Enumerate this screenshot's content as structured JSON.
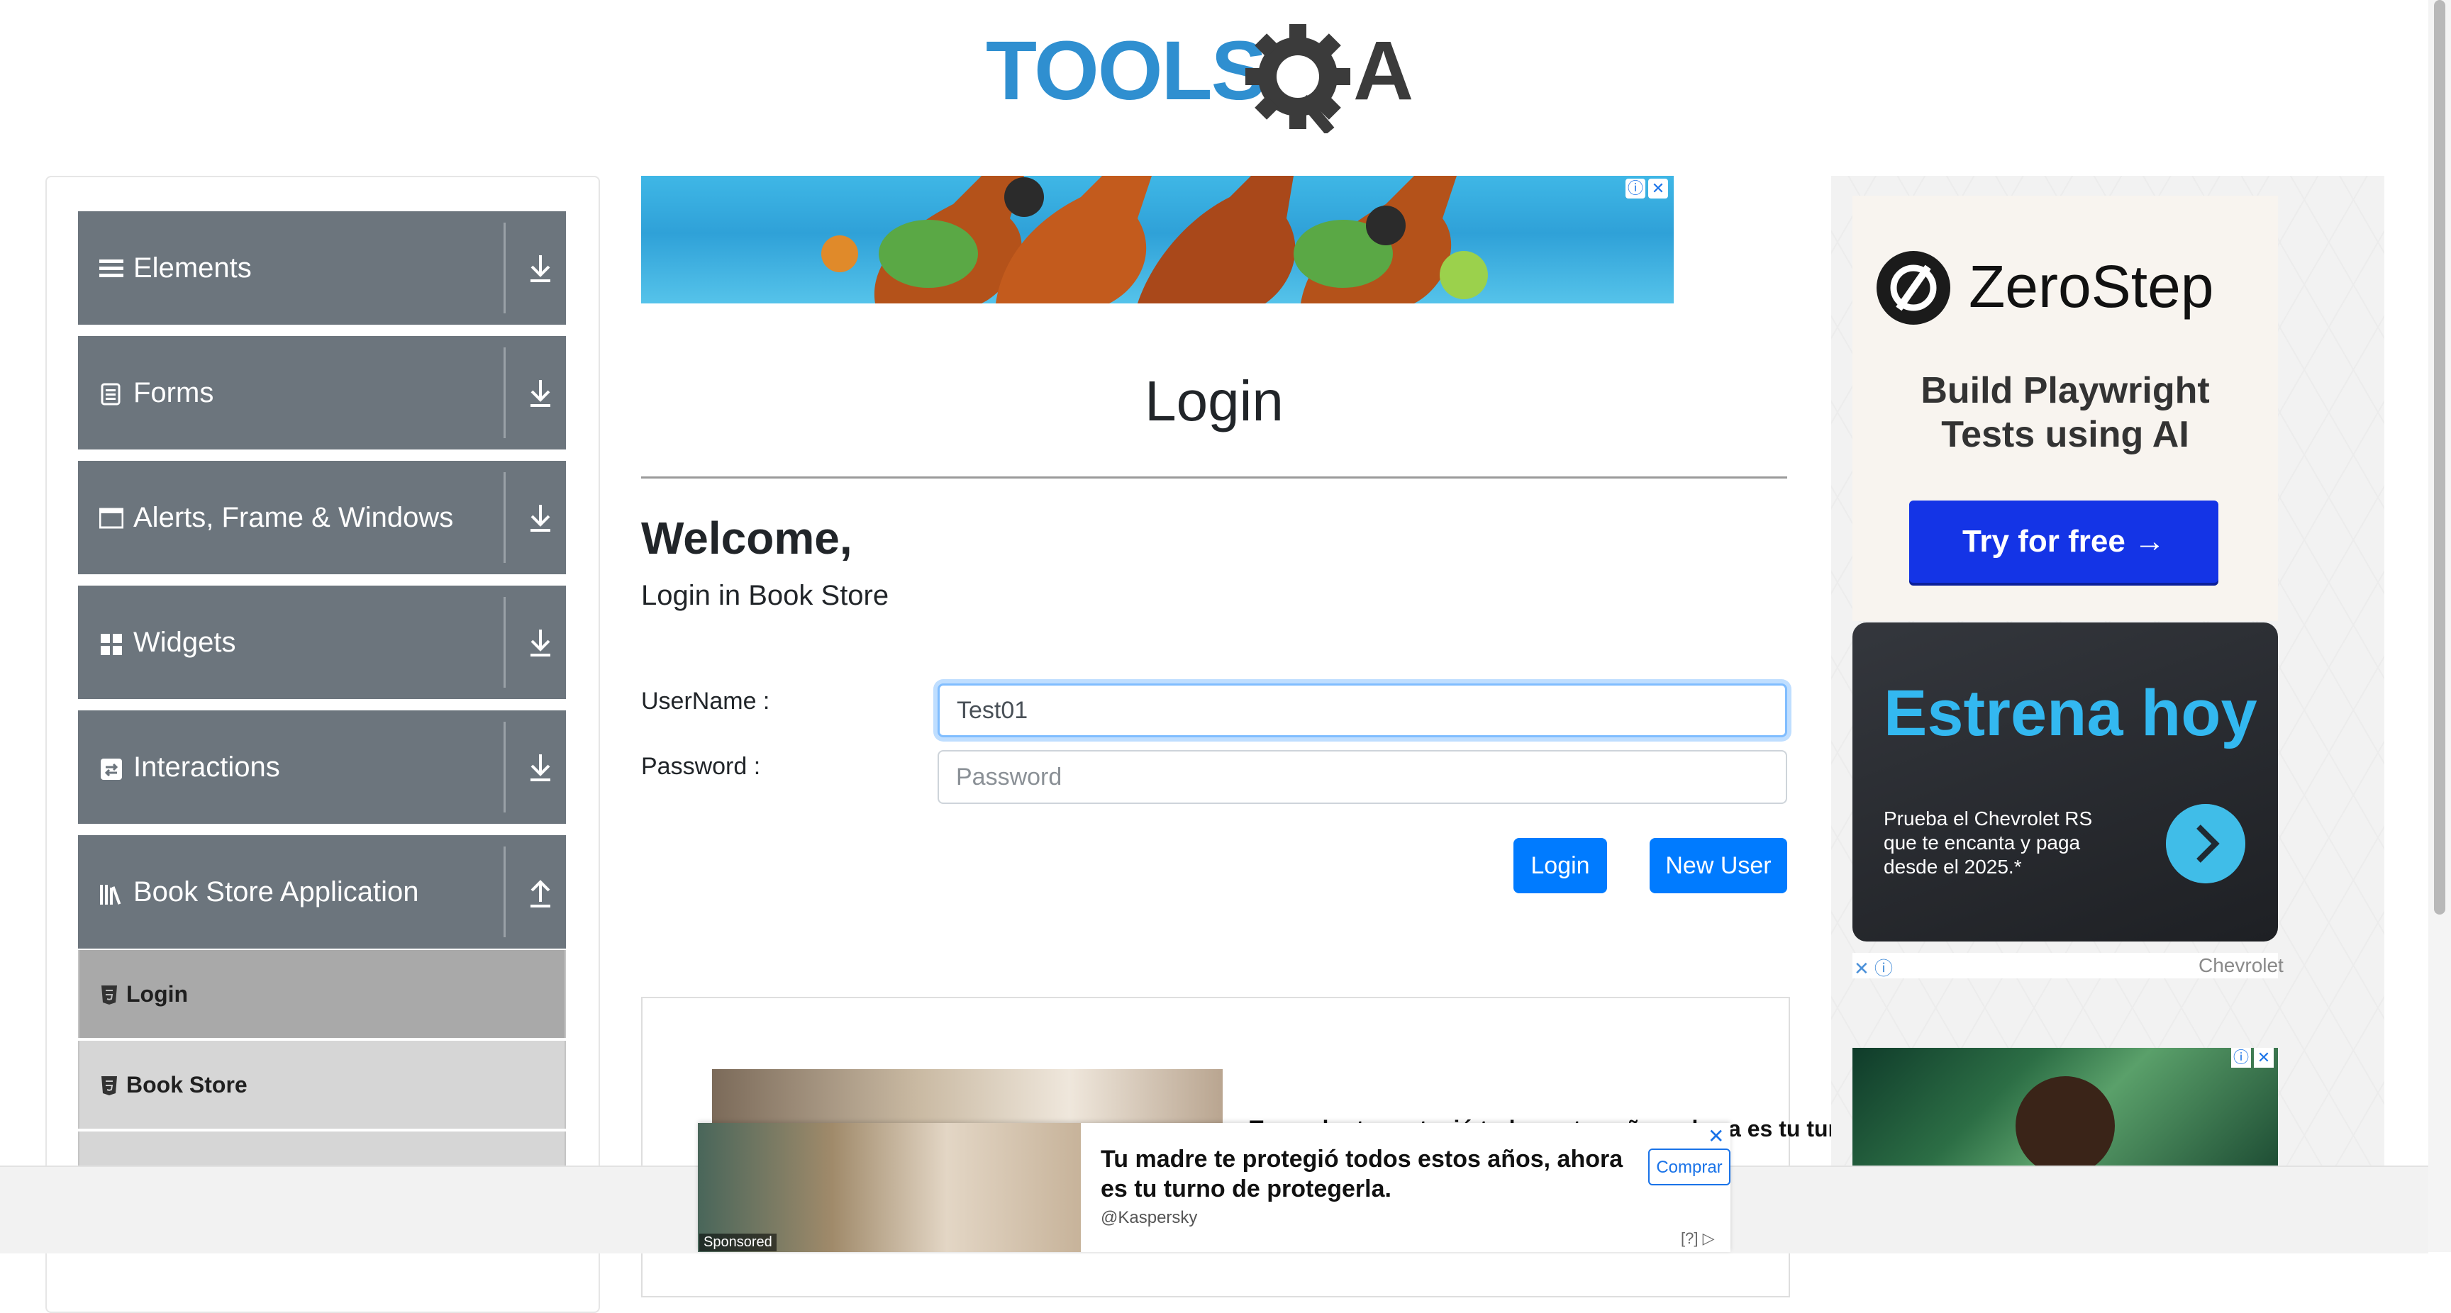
{
  "logo": {
    "text": "TOOLSQA"
  },
  "sidebar": {
    "groups": [
      {
        "label": "Elements",
        "icon": "menu-lines-icon",
        "state": "collapsed"
      },
      {
        "label": "Forms",
        "icon": "form-icon",
        "state": "collapsed"
      },
      {
        "label": "Alerts, Frame & Windows",
        "icon": "window-icon",
        "state": "collapsed"
      },
      {
        "label": "Widgets",
        "icon": "widgets-grid-icon",
        "state": "collapsed"
      },
      {
        "label": "Interactions",
        "icon": "interactions-icon",
        "state": "collapsed"
      },
      {
        "label": "Book Store Application",
        "icon": "books-icon",
        "state": "expanded"
      }
    ],
    "book_store_items": [
      {
        "label": "Login",
        "active": true
      },
      {
        "label": "Book Store",
        "active": false
      }
    ]
  },
  "main": {
    "title": "Login",
    "welcome": "Welcome,",
    "subheading": "Login in Book Store",
    "username_label": "UserName :",
    "password_label": "Password :",
    "username_value": "Test01",
    "password_placeholder": "Password",
    "login_button": "Login",
    "new_user_button": "New User"
  },
  "ads": {
    "zerostep_name": "ZeroStep",
    "zerostep_tagline_1": "Build Playwright",
    "zerostep_tagline_2": "Tests using AI",
    "zerostep_cta": "Try for free →",
    "chevrolet_title": "Estrena hoy",
    "chevrolet_desc": "Prueba el Chevrolet RS que te encanta y paga desde el 2025.*",
    "chevrolet_brand": "Chevrolet",
    "inline_text": "Tu madre te protegió todos estos años, ahora es tu tur",
    "bottom_headline": "Tu madre te protegió todos estos años, ahora es tu turno de protegerla.",
    "bottom_source": "@Kaspersky",
    "bottom_cta": "Comprar",
    "sponsored": "Sponsored",
    "ad_mark": "[?]"
  },
  "colors": {
    "sidebar_group_bg": "#6c757d",
    "sub_item_bg": "#d6d6d6",
    "sub_item_active_bg": "#a9a9a9",
    "primary_button": "#007bff",
    "logo_blue": "#2f8fd0",
    "logo_dark": "#3b3b3b"
  }
}
